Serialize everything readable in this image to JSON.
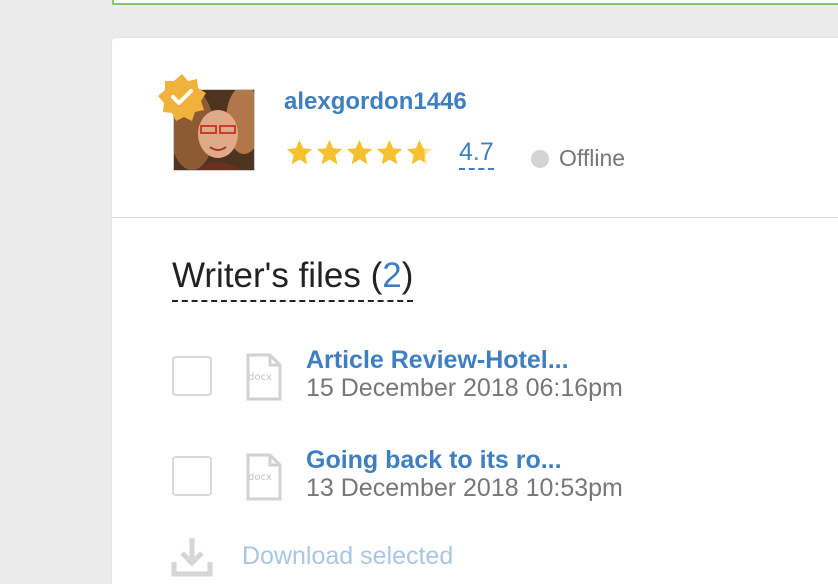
{
  "profile": {
    "username": "alexgordon1446",
    "rating": "4.7",
    "rating_value": 4.7,
    "rating_max": 5,
    "status": "Offline",
    "badge_icon": "verified-badge-icon",
    "avatar_icon": "user-avatar"
  },
  "files": {
    "title": "Writer's files",
    "count_open": "(",
    "count": "2",
    "count_close": ")",
    "items": [
      {
        "name": "Article Review-Hotel...",
        "date": "15 December 2018 06:16pm",
        "type": "docx",
        "checked": false
      },
      {
        "name": "Going back to its ro...",
        "date": "13 December 2018 10:53pm",
        "type": "docx",
        "checked": false
      }
    ]
  },
  "download": {
    "label": "Download selected",
    "icon": "download-icon"
  },
  "colors": {
    "accent": "#3f7fc1",
    "star": "#f5c12e",
    "badge": "#f0b23a",
    "top_border": "#8bc56b",
    "status_dot": "#d4d4d4",
    "disabled_link": "#a9c6e3"
  }
}
